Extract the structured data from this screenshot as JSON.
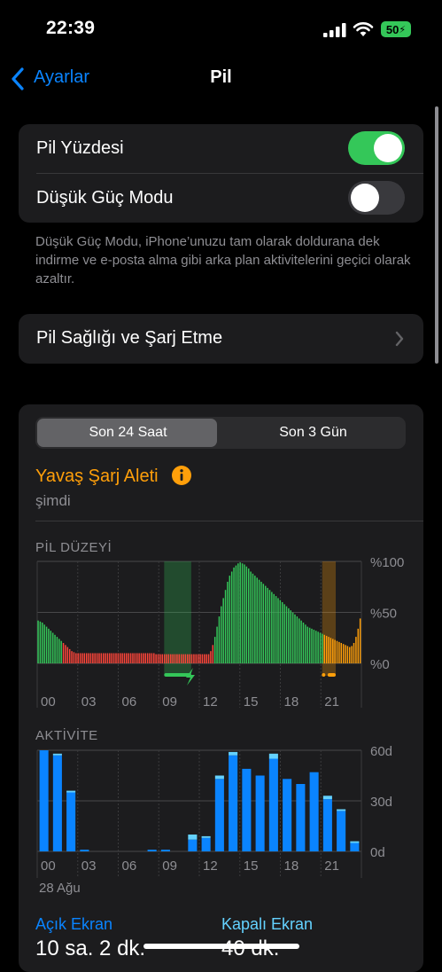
{
  "status": {
    "time": "22:39",
    "battery": "50"
  },
  "nav": {
    "back_label": "Ayarlar",
    "title": "Pil"
  },
  "settings": {
    "battery_percentage_label": "Pil Yüzdesi",
    "battery_percentage_on": true,
    "low_power_label": "Düşük Güç Modu",
    "low_power_on": false,
    "low_power_note": "Düşük Güç Modu, iPhone’unuzu tam olarak doldurana dek indirme ve e-posta alma gibi arka plan aktivitelerini geçici olarak azaltır.",
    "health_label": "Pil Sağlığı ve Şarj Etme"
  },
  "usage": {
    "segments": [
      "Son 24 Saat",
      "Son 3 Gün"
    ],
    "selected_segment": 0,
    "charger_title": "Yavaş Şarj Aleti",
    "charger_time": "şimdi",
    "battery_section": "PİL DÜZEYİ",
    "activity_section": "AKTİVİTE",
    "date_label": "28 Ağu",
    "screen_on_label": "Açık Ekran",
    "screen_on_value": "10 sa. 2 dk.",
    "screen_off_label": "Kapalı Ekran",
    "screen_off_value": "40 dk."
  },
  "chart_data": [
    {
      "type": "bar",
      "title": "PİL DÜZEYİ",
      "x_ticks": [
        "00",
        "03",
        "06",
        "09",
        "12",
        "15",
        "18",
        "21"
      ],
      "y_ticks": [
        "%100",
        "%50",
        "%0"
      ],
      "ylim": [
        0,
        100
      ],
      "unit": "%",
      "values": [
        42,
        41,
        40,
        38,
        36,
        34,
        32,
        30,
        28,
        26,
        24,
        22,
        20,
        18,
        16,
        14,
        12,
        11,
        10,
        10,
        10,
        10,
        10,
        10,
        10,
        10,
        10,
        10,
        10,
        10,
        10,
        10,
        10,
        10,
        10,
        10,
        10,
        10,
        10,
        10,
        10,
        10,
        10,
        10,
        10,
        10,
        10,
        10,
        10,
        10,
        10,
        10,
        10,
        10,
        10,
        10,
        9,
        9,
        9,
        9,
        9,
        9,
        9,
        9,
        9,
        9,
        9,
        9,
        9,
        9,
        9,
        9,
        9,
        9,
        9,
        9,
        9,
        9,
        9,
        9,
        9,
        9,
        12,
        18,
        26,
        36,
        46,
        56,
        64,
        72,
        80,
        86,
        90,
        94,
        96,
        98,
        99,
        98,
        97,
        95,
        93,
        90,
        88,
        86,
        84,
        82,
        80,
        78,
        76,
        74,
        72,
        70,
        68,
        66,
        64,
        62,
        60,
        58,
        56,
        54,
        52,
        50,
        48,
        46,
        44,
        42,
        40,
        38,
        36,
        35,
        34,
        33,
        32,
        31,
        30,
        29,
        28,
        27,
        26,
        25,
        24,
        23,
        22,
        21,
        20,
        19,
        18,
        17,
        16,
        17,
        20,
        26,
        34,
        44
      ],
      "colors": {
        "normal": "#34c759",
        "low": "#ff453a",
        "charging_orange": "#ff9f0a"
      },
      "charging_markers": "09-11 green lightning, 21 orange"
    },
    {
      "type": "bar",
      "title": "AKTİVİTE",
      "x_ticks": [
        "00",
        "03",
        "06",
        "09",
        "12",
        "15",
        "18",
        "21"
      ],
      "y_ticks": [
        "60d",
        "30d",
        "0d"
      ],
      "ylim": [
        0,
        60
      ],
      "unit": "dk",
      "hours": [
        0,
        1,
        2,
        3,
        4,
        5,
        6,
        7,
        8,
        9,
        10,
        11,
        12,
        13,
        14,
        15,
        16,
        17,
        18,
        19,
        20,
        21,
        22,
        23
      ],
      "screen_on": [
        60,
        57,
        35,
        1,
        0,
        0,
        0,
        0,
        1,
        1,
        0,
        7,
        8,
        43,
        57,
        49,
        45,
        55,
        43,
        40,
        47,
        31,
        24,
        5
      ],
      "screen_off": [
        0,
        1,
        1,
        0,
        0,
        0,
        0,
        0,
        0,
        0,
        0,
        3,
        1,
        2,
        2,
        0,
        0,
        3,
        0,
        0,
        0,
        2,
        1,
        1
      ],
      "colors": {
        "screen_on": "#0a84ff",
        "screen_off": "#64d2ff"
      }
    }
  ]
}
